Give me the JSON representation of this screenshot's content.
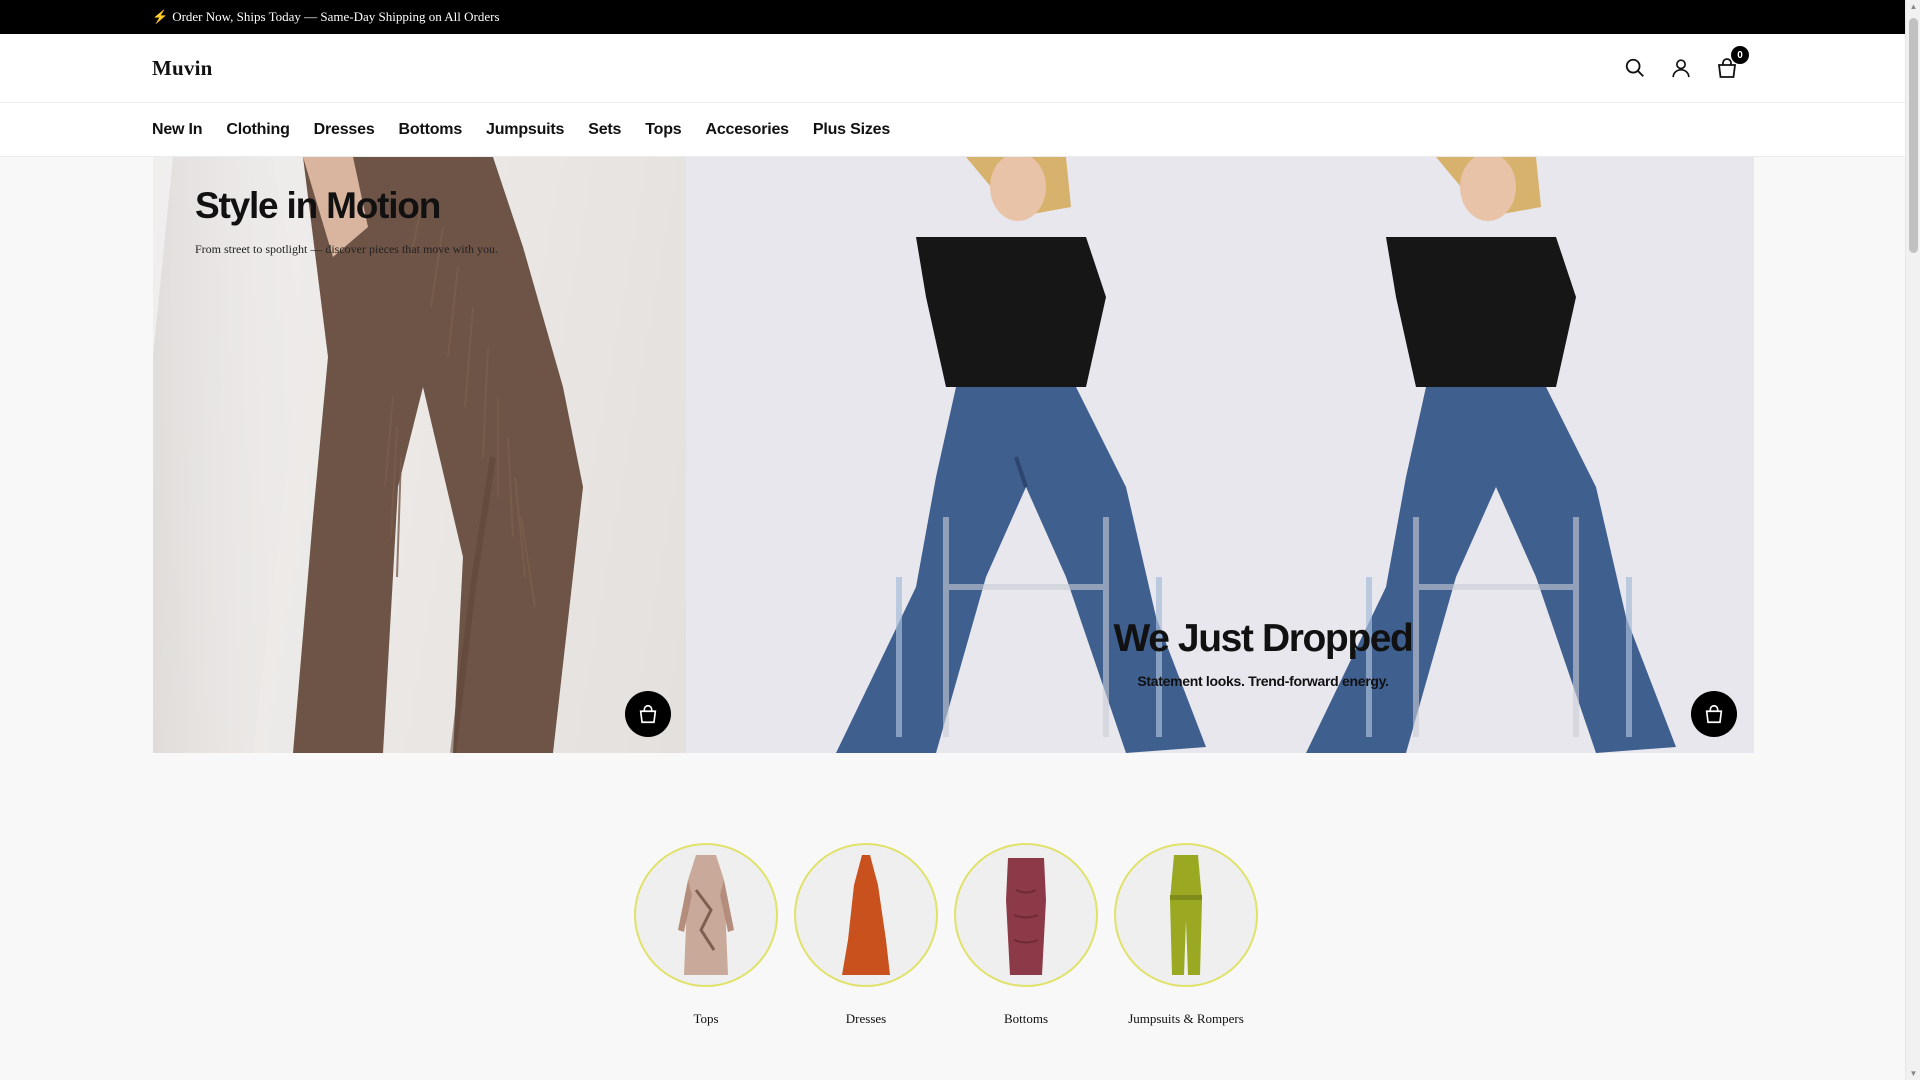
{
  "announcement": {
    "icon": "lightning-icon",
    "text": "Order Now, Ships Today — Same-Day Shipping on All Orders"
  },
  "header": {
    "logo": "Muvin",
    "cart_count": "0"
  },
  "nav": [
    "New In",
    "Clothing",
    "Dresses",
    "Bottoms",
    "Jumpsuits",
    "Sets",
    "Tops",
    "Accesories",
    "Plus Sizes"
  ],
  "hero": {
    "left": {
      "title": "Style in Motion",
      "subtitle": "From street to spotlight — discover pieces that move with you."
    },
    "right": {
      "title": "We Just Dropped",
      "subtitle": "Statement looks. Trend-forward energy."
    }
  },
  "categories": [
    {
      "label": "Tops"
    },
    {
      "label": "Dresses"
    },
    {
      "label": "Bottoms"
    },
    {
      "label": "Jumpsuits & Rompers"
    }
  ],
  "colors": {
    "announcement_bg": "#000000",
    "category_ring": "#e0e26a",
    "denim": "#3f5f8f",
    "fringe_pants": "#6e5446"
  }
}
